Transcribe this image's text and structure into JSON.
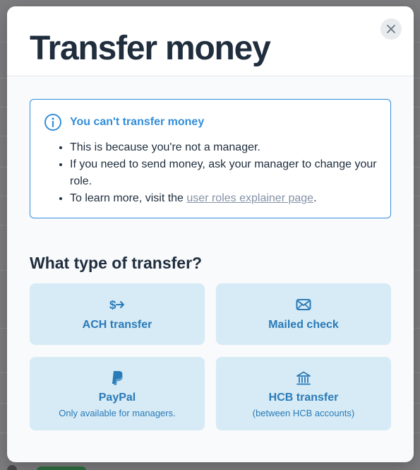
{
  "modal": {
    "title": "Transfer money",
    "close_label": "Close"
  },
  "notice": {
    "title": "You can't transfer money",
    "items": [
      "This is because you're not a manager.",
      "If you need to send money, ask your manager to change your role."
    ],
    "learn_prefix": "To learn more, visit the ",
    "learn_link": "user roles explainer page",
    "learn_suffix": "."
  },
  "section": {
    "title": "What type of transfer?"
  },
  "options": [
    {
      "label": "ACH transfer",
      "icon": "ach-transfer-icon"
    },
    {
      "label": "Mailed check",
      "icon": "mail-icon"
    },
    {
      "label": "PayPal",
      "sublabel": "Only available for managers.",
      "icon": "paypal-icon"
    },
    {
      "label": "HCB transfer",
      "sublabel": "(between HCB accounts)",
      "icon": "bank-icon"
    }
  ],
  "colors": {
    "accent": "#338eda",
    "card_bg": "#d6ebf5",
    "card_text": "#2a7ab8",
    "title_text": "#1f2d3d"
  }
}
